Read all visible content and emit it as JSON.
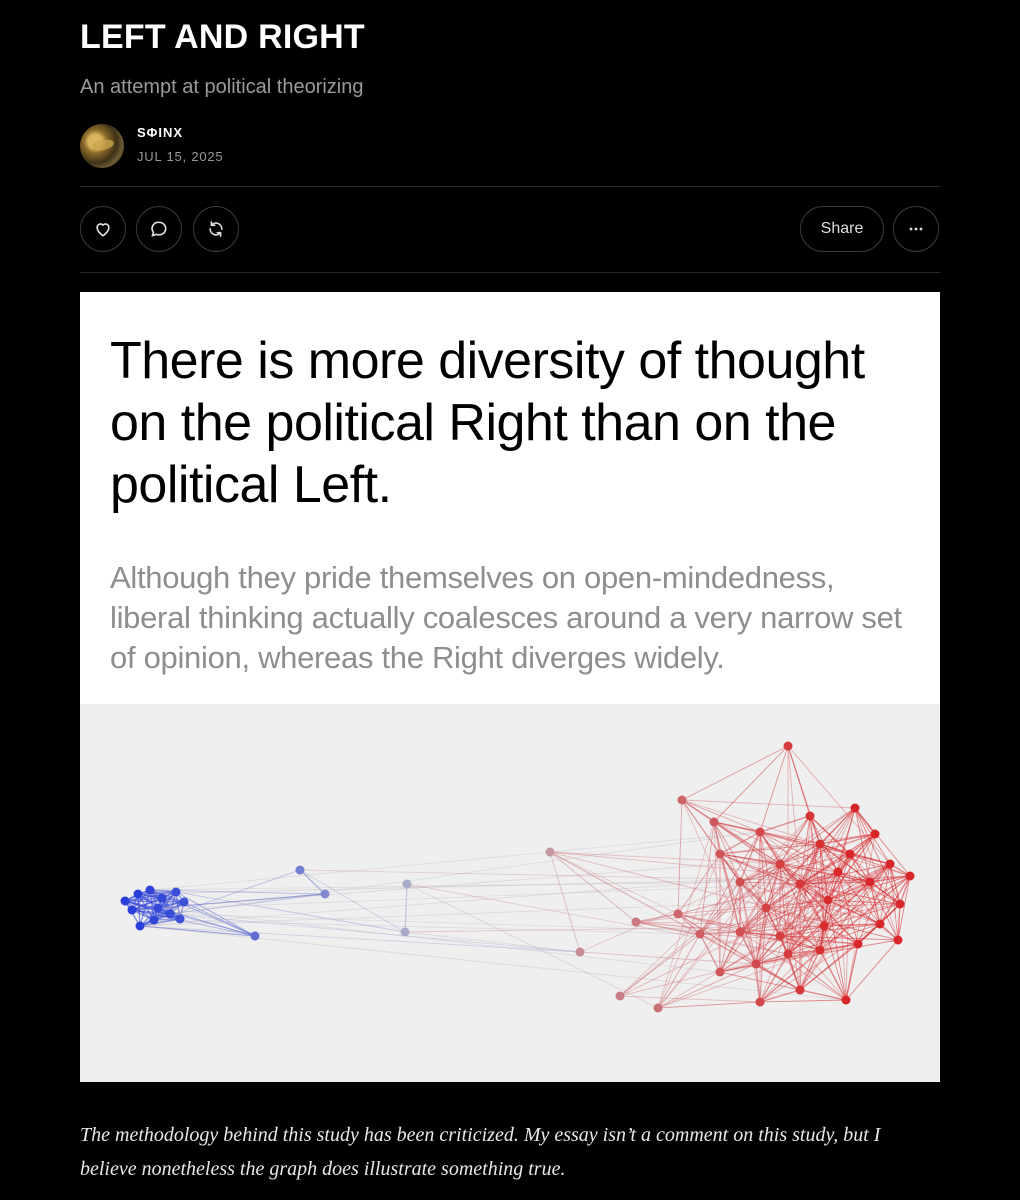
{
  "post": {
    "title": "LEFT AND RIGHT",
    "subtitle": "An attempt at political theorizing",
    "author": "SΦINX",
    "date": "JUL 15, 2025"
  },
  "actions": {
    "like_icon": "heart-icon",
    "comment_icon": "comment-icon",
    "restack_icon": "restack-icon",
    "share_label": "Share",
    "more_icon": "more-icon"
  },
  "figure": {
    "headline": "There is more diversity of thought on the political Right than on the political Left.",
    "subheadline": "Although they pride themselves on open-mindedness, liberal thinking actually coalesces around a very narrow set of opinion, whereas the Right diverges widely."
  },
  "caption": "The methodology behind this study has been criticized. My essay isn’t a comment on this study, but I believe nonetheless the graph does illustrate something true.",
  "colors": {
    "left_cluster": "#2a3fd8",
    "right_cluster": "#d8272a",
    "bridge_nodes": "#b9b9c4",
    "background": "#000000",
    "figure_background": "#ffffff",
    "graph_background": "#efefef"
  }
}
